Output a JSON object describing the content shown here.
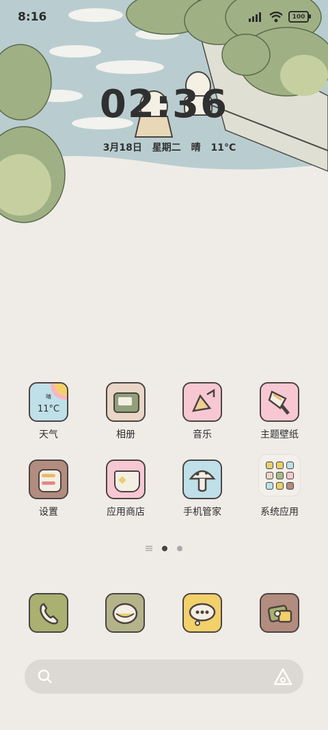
{
  "status": {
    "time": "8:16",
    "battery": "100"
  },
  "lock": {
    "clock": "02:36",
    "date": "3月18日",
    "weekday": "星期二",
    "weather": "晴",
    "temp": "11°C"
  },
  "apps": [
    {
      "label": "天气",
      "icon": "weather-icon",
      "temp": "11°C",
      "cond": "晴"
    },
    {
      "label": "相册",
      "icon": "gallery-icon"
    },
    {
      "label": "音乐",
      "icon": "music-icon"
    },
    {
      "label": "主题壁纸",
      "icon": "themes-icon"
    },
    {
      "label": "设置",
      "icon": "settings-icon"
    },
    {
      "label": "应用商店",
      "icon": "app-store-icon"
    },
    {
      "label": "手机管家",
      "icon": "security-icon"
    },
    {
      "label": "系统应用",
      "icon": "folder-icon"
    }
  ],
  "dock": [
    {
      "icon": "phone-icon"
    },
    {
      "icon": "messages-icon"
    },
    {
      "icon": "chat-icon"
    },
    {
      "icon": "camera-icon"
    }
  ],
  "page_indicator": {
    "pages": 2,
    "current": 1
  },
  "colors": {
    "bg": "#efece8",
    "sky": "#b9cdd0",
    "tree": "#a9b98a"
  }
}
